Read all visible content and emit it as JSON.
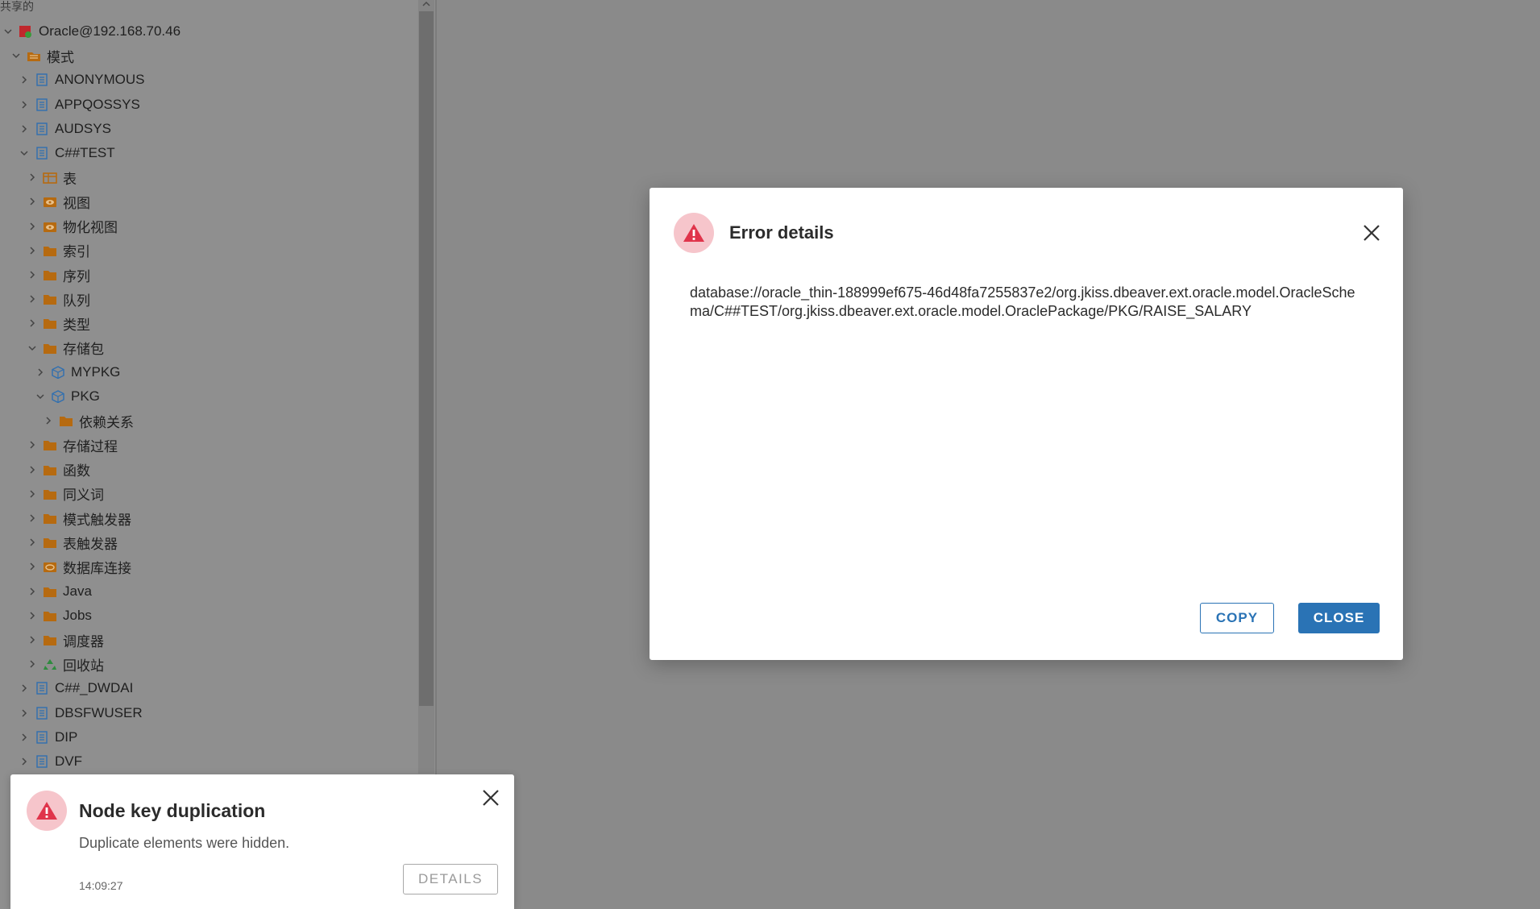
{
  "navigator": {
    "shared_label": "共享的",
    "tree": [
      {
        "label": "Oracle@192.168.70.46",
        "icon": "oracle-connection-icon",
        "expanded": true,
        "level": 0
      },
      {
        "label": "模式",
        "icon": "schemas-folder-icon",
        "expanded": true,
        "level": 1
      },
      {
        "label": "ANONYMOUS",
        "icon": "schema-icon",
        "expanded": false,
        "level": 2
      },
      {
        "label": "APPQOSSYS",
        "icon": "schema-icon",
        "expanded": false,
        "level": 2
      },
      {
        "label": "AUDSYS",
        "icon": "schema-icon",
        "expanded": false,
        "level": 2
      },
      {
        "label": "C##TEST",
        "icon": "schema-icon",
        "expanded": true,
        "level": 2
      },
      {
        "label": "表",
        "icon": "table-folder-icon",
        "expanded": false,
        "level": 3
      },
      {
        "label": "视图",
        "icon": "view-folder-icon",
        "expanded": false,
        "level": 3
      },
      {
        "label": "物化视图",
        "icon": "view-folder-icon",
        "expanded": false,
        "level": 3
      },
      {
        "label": "索引",
        "icon": "folder-icon",
        "expanded": false,
        "level": 3
      },
      {
        "label": "序列",
        "icon": "folder-icon",
        "expanded": false,
        "level": 3
      },
      {
        "label": "队列",
        "icon": "folder-icon",
        "expanded": false,
        "level": 3
      },
      {
        "label": "类型",
        "icon": "folder-icon",
        "expanded": false,
        "level": 3
      },
      {
        "label": "存储包",
        "icon": "folder-icon",
        "expanded": true,
        "level": 3
      },
      {
        "label": "MYPKG",
        "icon": "package-icon",
        "expanded": false,
        "level": 4
      },
      {
        "label": "PKG",
        "icon": "package-icon",
        "expanded": true,
        "level": 4
      },
      {
        "label": "依赖关系",
        "icon": "folder-icon",
        "expanded": false,
        "level": 5
      },
      {
        "label": "存储过程",
        "icon": "folder-icon",
        "expanded": false,
        "level": 3
      },
      {
        "label": "函数",
        "icon": "folder-icon",
        "expanded": false,
        "level": 3
      },
      {
        "label": "同义词",
        "icon": "folder-icon",
        "expanded": false,
        "level": 3
      },
      {
        "label": "模式触发器",
        "icon": "folder-icon",
        "expanded": false,
        "level": 3
      },
      {
        "label": "表触发器",
        "icon": "folder-icon",
        "expanded": false,
        "level": 3
      },
      {
        "label": "数据库连接",
        "icon": "link-folder-icon",
        "expanded": false,
        "level": 3
      },
      {
        "label": "Java",
        "icon": "folder-icon",
        "expanded": false,
        "level": 3
      },
      {
        "label": "Jobs",
        "icon": "folder-icon",
        "expanded": false,
        "level": 3
      },
      {
        "label": "调度器",
        "icon": "folder-icon",
        "expanded": false,
        "level": 3
      },
      {
        "label": "回收站",
        "icon": "recycle-icon",
        "expanded": false,
        "level": 3
      },
      {
        "label": "C##_DWDAI",
        "icon": "schema-icon",
        "expanded": false,
        "level": 2
      },
      {
        "label": "DBSFWUSER",
        "icon": "schema-icon",
        "expanded": false,
        "level": 2
      },
      {
        "label": "DIP",
        "icon": "schema-icon",
        "expanded": false,
        "level": 2
      },
      {
        "label": "DVF",
        "icon": "schema-icon",
        "expanded": false,
        "level": 2
      }
    ]
  },
  "dialog": {
    "title": "Error details",
    "message": "database://oracle_thin-188999ef675-46d48fa7255837e2/org.jkiss.dbeaver.ext.oracle.model.OracleSchema/C##TEST/org.jkiss.dbeaver.ext.oracle.model.OraclePackage/PKG/RAISE_SALARY",
    "copy_label": "COPY",
    "close_label": "CLOSE"
  },
  "toast": {
    "title": "Node key duplication",
    "message": "Duplicate elements were hidden.",
    "time": "14:09:27",
    "details_label": "DETAILS"
  },
  "colors": {
    "accent": "#2a73b5",
    "error_badge_bg": "#f6c5cb",
    "error_icon": "#e0344b",
    "overlay": "#8a8a8a",
    "folder": "#b66a10"
  }
}
